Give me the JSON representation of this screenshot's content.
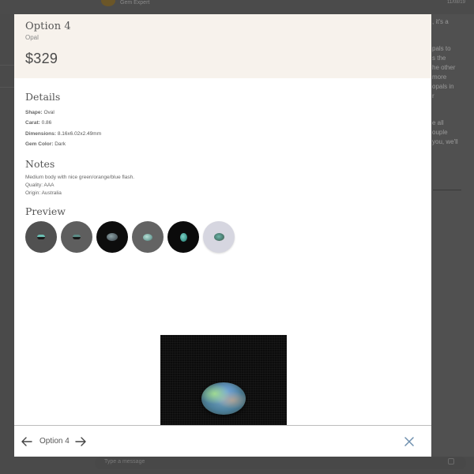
{
  "background": {
    "sender_name": "Gem Expert",
    "date": "11/08/19",
    "message_fragments": [
      ", it's a",
      "",
      "pals to",
      "s the",
      "he other",
      "more",
      "opals in",
      "r",
      "",
      "",
      "e all",
      "ouple",
      "you, we'll"
    ],
    "composer_placeholder": "Type a message"
  },
  "modal": {
    "title": "Option 4",
    "subtitle": "Opal",
    "price": "$329",
    "details": {
      "heading": "Details",
      "rows": [
        {
          "label": "Shape:",
          "value": "Oval"
        },
        {
          "label": "Carat:",
          "value": "0.86"
        },
        {
          "label": "Dimensions:",
          "value": "8.16x6.02x2.49mm"
        },
        {
          "label": "Gem Color:",
          "value": "Dark"
        }
      ]
    },
    "notes": {
      "heading": "Notes",
      "lines": [
        "Medium body with nice green/orange/blue flash.",
        "Quality: AAA",
        "Origin: Australia"
      ]
    },
    "preview": {
      "heading": "Preview",
      "thumbnails": [
        {
          "name": "thumb-side-view-grey"
        },
        {
          "name": "thumb-side-view-dark-grey"
        },
        {
          "name": "thumb-top-view-black"
        },
        {
          "name": "thumb-top-view-grey"
        },
        {
          "name": "thumb-vertical-view-black"
        },
        {
          "name": "thumb-top-view-light"
        }
      ],
      "selected_index": 2
    },
    "footer": {
      "label": "Option 4",
      "prev_icon": "arrow-left-icon",
      "next_icon": "arrow-right-icon",
      "close_icon": "close-icon"
    },
    "colors": {
      "header_bg": "#f7f2ec",
      "close_icon": "#6e8fae"
    }
  }
}
